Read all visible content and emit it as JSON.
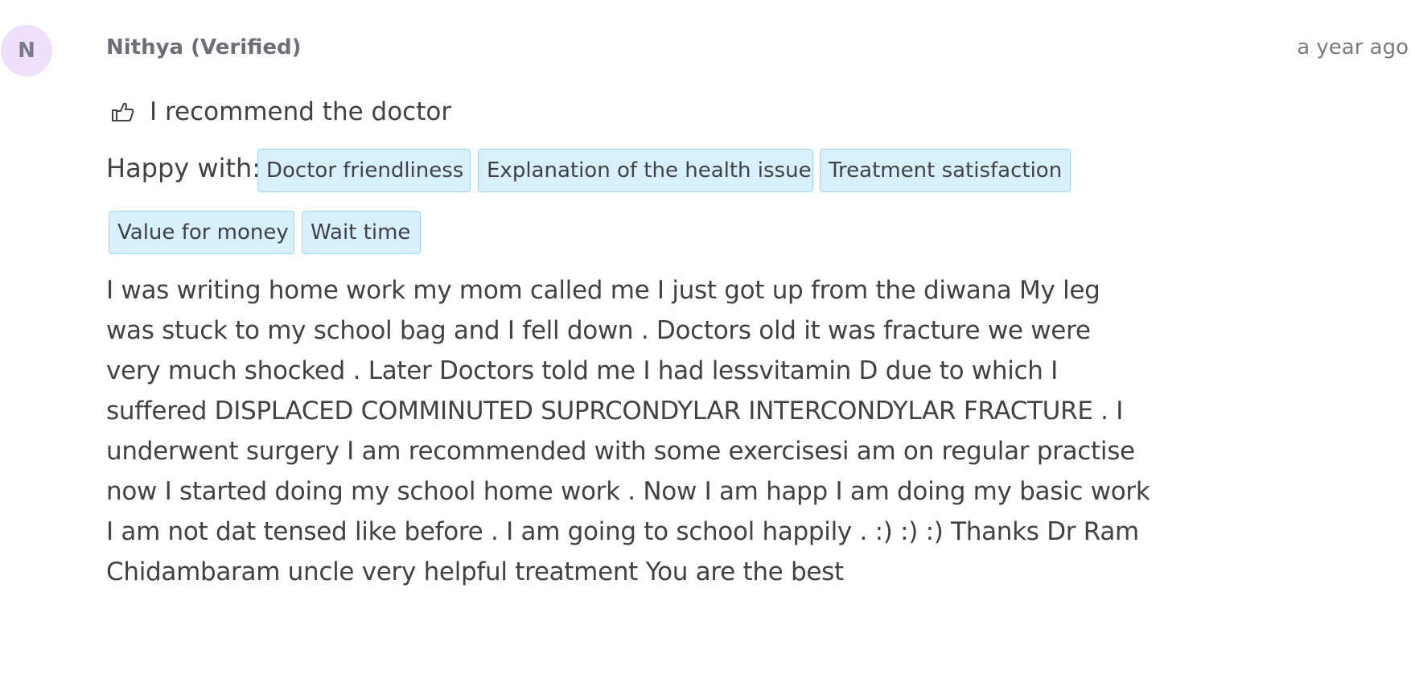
{
  "review": {
    "avatar_initial": "N",
    "reviewer": "Nithya (Verified)",
    "time": "a year ago",
    "recommend_text": "I recommend the doctor",
    "happy_with_label": "Happy with:",
    "tags": [
      "Doctor friendliness",
      "Explanation of the health issue",
      "Treatment satisfaction",
      "Value for money",
      "Wait time"
    ],
    "text": "I was writing home work my mom called me I just got up from the diwana My leg was stuck to my school bag and I fell down . Doctors old it was fracture we were very much shocked . Later Doctors told me I had lessvitamin D due to which I suffered DISPLACED COMMINUTED SUPRCONDYLAR INTERCONDYLAR FRACTURE . I underwent surgery I am recommended with some exercisesi am on regular practise now I started doing my school home work . Now I am happ I am doing my basic work I am not dat tensed like before . I am going to school happily . :) :) :) Thanks Dr Ram Chidambaram uncle very helpful treatment You are the best"
  },
  "icons": {
    "recommend": "thumbs-up-icon"
  },
  "colors": {
    "avatar_bg": "#efe0fc",
    "tag_bg": "#d8f0fb",
    "tag_border": "#9ed8ef",
    "text": "#414146"
  }
}
